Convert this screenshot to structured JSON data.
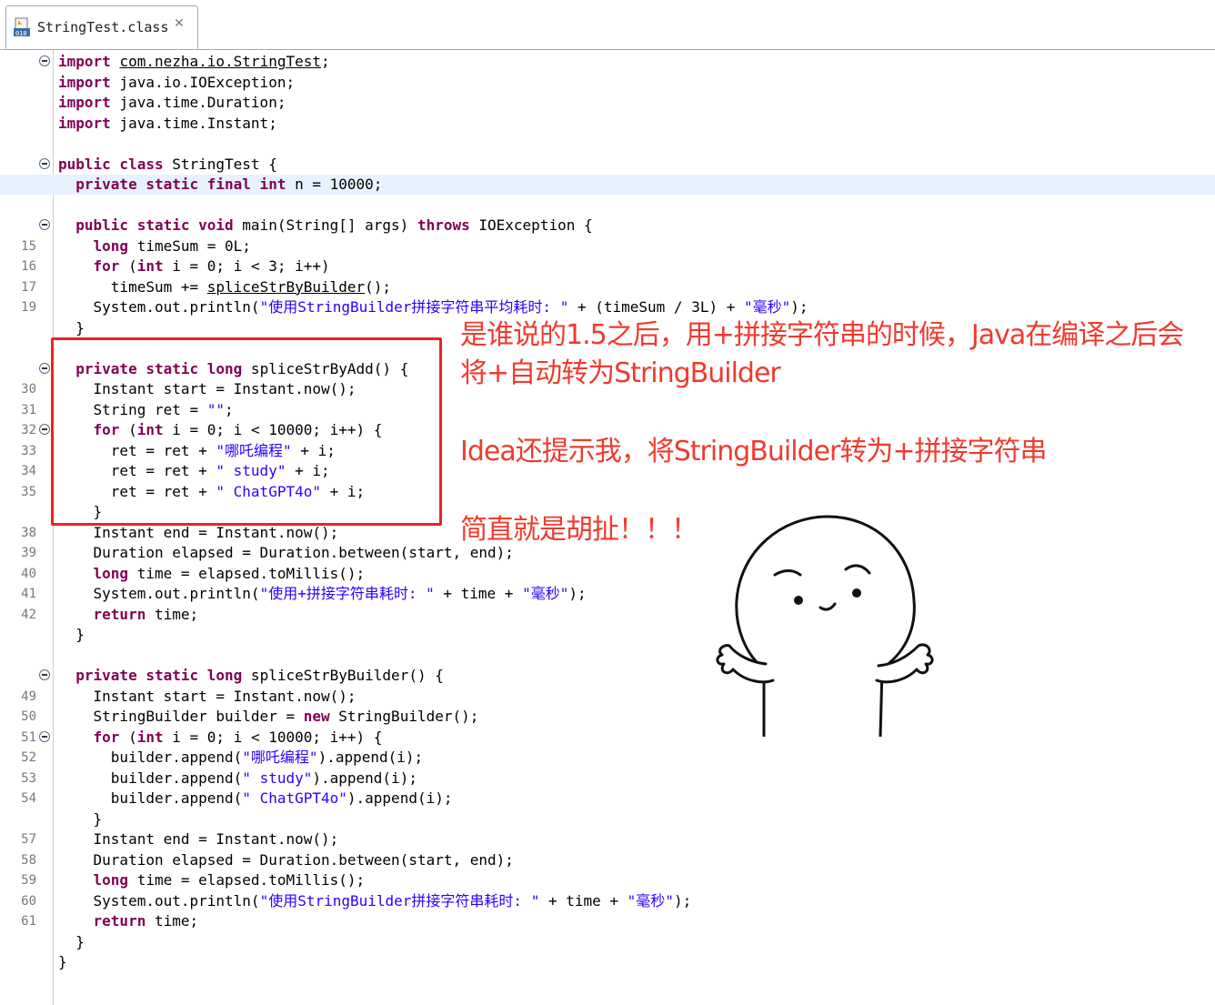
{
  "tab": {
    "label": "StringTest.class",
    "icon": "class-file-icon",
    "close_glyph": "✕"
  },
  "code_lines": [
    {
      "num": "",
      "fold": true,
      "tokens": [
        [
          "kw",
          "import"
        ],
        [
          "txt",
          " "
        ],
        [
          "u",
          "com.nezha.io.StringTest"
        ],
        [
          "txt",
          ";"
        ]
      ]
    },
    {
      "num": "",
      "tokens": [
        [
          "kw",
          "import"
        ],
        [
          "txt",
          " java.io.IOException;"
        ]
      ]
    },
    {
      "num": "",
      "tokens": [
        [
          "kw",
          "import"
        ],
        [
          "txt",
          " java.time.Duration;"
        ]
      ]
    },
    {
      "num": "",
      "tokens": [
        [
          "kw",
          "import"
        ],
        [
          "txt",
          " java.time.Instant;"
        ]
      ]
    },
    {
      "num": "",
      "tokens": []
    },
    {
      "num": "",
      "fold": true,
      "tokens": [
        [
          "kw",
          "public class"
        ],
        [
          "txt",
          " StringTest {"
        ]
      ]
    },
    {
      "num": "",
      "current": true,
      "tokens": [
        [
          "txt",
          "  "
        ],
        [
          "kw",
          "private static final int"
        ],
        [
          "txt",
          " n = 10000;"
        ]
      ]
    },
    {
      "num": "",
      "tokens": []
    },
    {
      "num": "",
      "fold": true,
      "tokens": [
        [
          "txt",
          "  "
        ],
        [
          "kw",
          "public static void"
        ],
        [
          "txt",
          " main(String[] args) "
        ],
        [
          "kw",
          "throws"
        ],
        [
          "txt",
          " IOException {"
        ]
      ]
    },
    {
      "num": "15",
      "tokens": [
        [
          "txt",
          "    "
        ],
        [
          "kw",
          "long"
        ],
        [
          "txt",
          " timeSum = 0L;"
        ]
      ]
    },
    {
      "num": "16",
      "tokens": [
        [
          "txt",
          "    "
        ],
        [
          "kw",
          "for"
        ],
        [
          "txt",
          " ("
        ],
        [
          "kw",
          "int"
        ],
        [
          "txt",
          " i = 0; i < 3; i++)"
        ]
      ]
    },
    {
      "num": "17",
      "tokens": [
        [
          "txt",
          "      timeSum += "
        ],
        [
          "u",
          "spliceStrByBuilder"
        ],
        [
          "txt",
          "();"
        ]
      ]
    },
    {
      "num": "19",
      "tokens": [
        [
          "txt",
          "    System.out.println("
        ],
        [
          "str",
          "\"使用StringBuilder拼接字符串平均耗时: \""
        ],
        [
          "txt",
          " + (timeSum / 3L) + "
        ],
        [
          "str",
          "\"毫秒\""
        ],
        [
          "txt",
          ");"
        ]
      ]
    },
    {
      "num": "",
      "tokens": [
        [
          "txt",
          "  }"
        ]
      ]
    },
    {
      "num": "",
      "tokens": []
    },
    {
      "num": "",
      "fold": true,
      "tokens": [
        [
          "txt",
          "  "
        ],
        [
          "kw",
          "private static long"
        ],
        [
          "txt",
          " spliceStrByAdd() {"
        ]
      ]
    },
    {
      "num": "30",
      "tokens": [
        [
          "txt",
          "    Instant start = Instant.now();"
        ]
      ]
    },
    {
      "num": "31",
      "tokens": [
        [
          "txt",
          "    String ret = "
        ],
        [
          "str",
          "\"\""
        ],
        [
          "txt",
          ";"
        ]
      ]
    },
    {
      "num": "32",
      "fold": true,
      "tokens": [
        [
          "txt",
          "    "
        ],
        [
          "kw",
          "for"
        ],
        [
          "txt",
          " ("
        ],
        [
          "kw",
          "int"
        ],
        [
          "txt",
          " i = 0; i < 10000; i++) {"
        ]
      ]
    },
    {
      "num": "33",
      "tokens": [
        [
          "txt",
          "      ret = ret + "
        ],
        [
          "str",
          "\"哪吒编程\""
        ],
        [
          "txt",
          " + i;"
        ]
      ]
    },
    {
      "num": "34",
      "tokens": [
        [
          "txt",
          "      ret = ret + "
        ],
        [
          "str",
          "\" study\""
        ],
        [
          "txt",
          " + i;"
        ]
      ]
    },
    {
      "num": "35",
      "tokens": [
        [
          "txt",
          "      ret = ret + "
        ],
        [
          "str",
          "\" ChatGPT4o\""
        ],
        [
          "txt",
          " + i;"
        ]
      ]
    },
    {
      "num": "",
      "tokens": [
        [
          "txt",
          "    }"
        ]
      ]
    },
    {
      "num": "38",
      "tokens": [
        [
          "txt",
          "    Instant end = Instant.now();"
        ]
      ]
    },
    {
      "num": "39",
      "tokens": [
        [
          "txt",
          "    Duration elapsed = Duration.between(start, end);"
        ]
      ]
    },
    {
      "num": "40",
      "tokens": [
        [
          "txt",
          "    "
        ],
        [
          "kw",
          "long"
        ],
        [
          "txt",
          " time = elapsed.toMillis();"
        ]
      ]
    },
    {
      "num": "41",
      "tokens": [
        [
          "txt",
          "    System.out.println("
        ],
        [
          "str",
          "\"使用+拼接字符串耗时: \""
        ],
        [
          "txt",
          " + time + "
        ],
        [
          "str",
          "\"毫秒\""
        ],
        [
          "txt",
          ");"
        ]
      ]
    },
    {
      "num": "42",
      "tokens": [
        [
          "txt",
          "    "
        ],
        [
          "kw",
          "return"
        ],
        [
          "txt",
          " time;"
        ]
      ]
    },
    {
      "num": "",
      "tokens": [
        [
          "txt",
          "  }"
        ]
      ]
    },
    {
      "num": "",
      "tokens": []
    },
    {
      "num": "",
      "fold": true,
      "tokens": [
        [
          "txt",
          "  "
        ],
        [
          "kw",
          "private static long"
        ],
        [
          "txt",
          " spliceStrByBuilder() {"
        ]
      ]
    },
    {
      "num": "49",
      "tokens": [
        [
          "txt",
          "    Instant start = Instant.now();"
        ]
      ]
    },
    {
      "num": "50",
      "tokens": [
        [
          "txt",
          "    StringBuilder builder = "
        ],
        [
          "kw",
          "new"
        ],
        [
          "txt",
          " StringBuilder();"
        ]
      ]
    },
    {
      "num": "51",
      "fold": true,
      "tokens": [
        [
          "txt",
          "    "
        ],
        [
          "kw",
          "for"
        ],
        [
          "txt",
          " ("
        ],
        [
          "kw",
          "int"
        ],
        [
          "txt",
          " i = 0; i < 10000; i++) {"
        ]
      ]
    },
    {
      "num": "52",
      "tokens": [
        [
          "txt",
          "      builder.append("
        ],
        [
          "str",
          "\"哪吒编程\""
        ],
        [
          "txt",
          ").append(i);"
        ]
      ]
    },
    {
      "num": "53",
      "tokens": [
        [
          "txt",
          "      builder.append("
        ],
        [
          "str",
          "\" study\""
        ],
        [
          "txt",
          ").append(i);"
        ]
      ]
    },
    {
      "num": "54",
      "tokens": [
        [
          "txt",
          "      builder.append("
        ],
        [
          "str",
          "\" ChatGPT4o\""
        ],
        [
          "txt",
          ").append(i);"
        ]
      ]
    },
    {
      "num": "",
      "tokens": [
        [
          "txt",
          "    }"
        ]
      ]
    },
    {
      "num": "57",
      "tokens": [
        [
          "txt",
          "    Instant end = Instant.now();"
        ]
      ]
    },
    {
      "num": "58",
      "tokens": [
        [
          "txt",
          "    Duration elapsed = Duration.between(start, end);"
        ]
      ]
    },
    {
      "num": "59",
      "tokens": [
        [
          "txt",
          "    "
        ],
        [
          "kw",
          "long"
        ],
        [
          "txt",
          " time = elapsed.toMillis();"
        ]
      ]
    },
    {
      "num": "60",
      "tokens": [
        [
          "txt",
          "    System.out.println("
        ],
        [
          "str",
          "\"使用StringBuilder拼接字符串耗时: \""
        ],
        [
          "txt",
          " + time + "
        ],
        [
          "str",
          "\"毫秒\""
        ],
        [
          "txt",
          ");"
        ]
      ]
    },
    {
      "num": "61",
      "tokens": [
        [
          "txt",
          "    "
        ],
        [
          "kw",
          "return"
        ],
        [
          "txt",
          " time;"
        ]
      ]
    },
    {
      "num": "",
      "tokens": [
        [
          "txt",
          "  }"
        ]
      ]
    },
    {
      "num": "",
      "tokens": [
        [
          "txt",
          "}"
        ]
      ]
    }
  ],
  "annotations": {
    "note1": "是谁说的1.5之后，用+拼接字符串的时候，Java在编译之后会将+自动转为StringBuilder",
    "note2": "Idea还提示我，将StringBuilder转为+拼接字符串",
    "note3": "简直就是胡扯！！！"
  },
  "colors": {
    "keyword": "#7f0055",
    "string": "#2a00ff",
    "annotation": "#f03a2e",
    "highlight_box": "#ee2222",
    "current_line": "#e8f2fe"
  },
  "meme": {
    "icon": "shrugging-cartoon-figure"
  }
}
